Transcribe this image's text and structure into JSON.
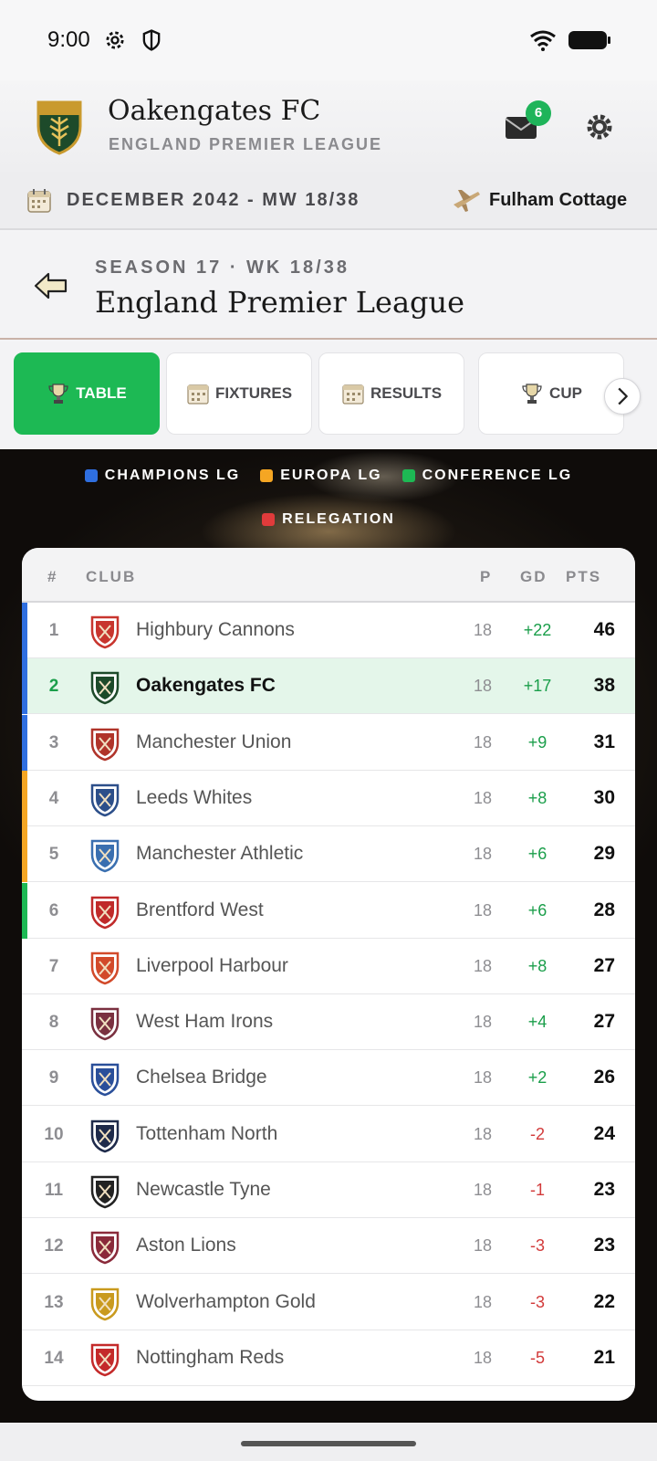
{
  "status_bar": {
    "time": "9:00"
  },
  "header": {
    "club_name": "Oakengates FC",
    "league": "ENGLAND PREMIER LEAGUE",
    "notification_count": "6"
  },
  "date_bar": {
    "date_label": "DECEMBER 2042 - MW 18/38",
    "stadium": "Fulham Cottage"
  },
  "season": {
    "subtitle": "SEASON 17 · WK 18/38",
    "title": "England Premier League"
  },
  "tabs": [
    {
      "label": "TABLE",
      "icon": "trophy-icon",
      "active": true
    },
    {
      "label": "FIXTURES",
      "icon": "calendar-icon",
      "active": false
    },
    {
      "label": "RESULTS",
      "icon": "calendar-icon",
      "active": false
    },
    {
      "label": "CUP",
      "icon": "trophy-icon",
      "active": false
    }
  ],
  "legend": [
    {
      "label": "CHAMPIONS LG",
      "color": "#2f6fe0"
    },
    {
      "label": "EUROPA LG",
      "color": "#f5a623"
    },
    {
      "label": "CONFERENCE LG",
      "color": "#1db954"
    },
    {
      "label": "RELEGATION",
      "color": "#e03b3b"
    }
  ],
  "table": {
    "headers": {
      "pos": "#",
      "club": "CLUB",
      "played": "P",
      "gd": "GD",
      "pts": "PTS"
    },
    "rows": [
      {
        "pos": "1",
        "club": "Highbury Cannons",
        "played": "18",
        "gd": "+22",
        "pts": "46",
        "zone": "champions"
      },
      {
        "pos": "2",
        "club": "Oakengates FC",
        "played": "18",
        "gd": "+17",
        "pts": "38",
        "zone": "champions",
        "highlight": true
      },
      {
        "pos": "3",
        "club": "Manchester Union",
        "played": "18",
        "gd": "+9",
        "pts": "31",
        "zone": "champions"
      },
      {
        "pos": "4",
        "club": "Leeds Whites",
        "played": "18",
        "gd": "+8",
        "pts": "30",
        "zone": "europa"
      },
      {
        "pos": "5",
        "club": "Manchester Athletic",
        "played": "18",
        "gd": "+6",
        "pts": "29",
        "zone": "europa"
      },
      {
        "pos": "6",
        "club": "Brentford West",
        "played": "18",
        "gd": "+6",
        "pts": "28",
        "zone": "conference"
      },
      {
        "pos": "7",
        "club": "Liverpool Harbour",
        "played": "18",
        "gd": "+8",
        "pts": "27",
        "zone": ""
      },
      {
        "pos": "8",
        "club": "West Ham Irons",
        "played": "18",
        "gd": "+4",
        "pts": "27",
        "zone": ""
      },
      {
        "pos": "9",
        "club": "Chelsea Bridge",
        "played": "18",
        "gd": "+2",
        "pts": "26",
        "zone": ""
      },
      {
        "pos": "10",
        "club": "Tottenham North",
        "played": "18",
        "gd": "-2",
        "pts": "24",
        "zone": ""
      },
      {
        "pos": "11",
        "club": "Newcastle Tyne",
        "played": "18",
        "gd": "-1",
        "pts": "23",
        "zone": ""
      },
      {
        "pos": "12",
        "club": "Aston Lions",
        "played": "18",
        "gd": "-3",
        "pts": "23",
        "zone": ""
      },
      {
        "pos": "13",
        "club": "Wolverhampton Gold",
        "played": "18",
        "gd": "-3",
        "pts": "22",
        "zone": ""
      },
      {
        "pos": "14",
        "club": "Nottingham Reds",
        "played": "18",
        "gd": "-5",
        "pts": "21",
        "zone": ""
      }
    ]
  },
  "colors": {
    "accent": "#1db954",
    "champions": "#2f6fe0",
    "europa": "#f5a623",
    "conference": "#1db954",
    "positive_gd": "#1a9e4a",
    "negative_gd": "#d23a3a"
  }
}
